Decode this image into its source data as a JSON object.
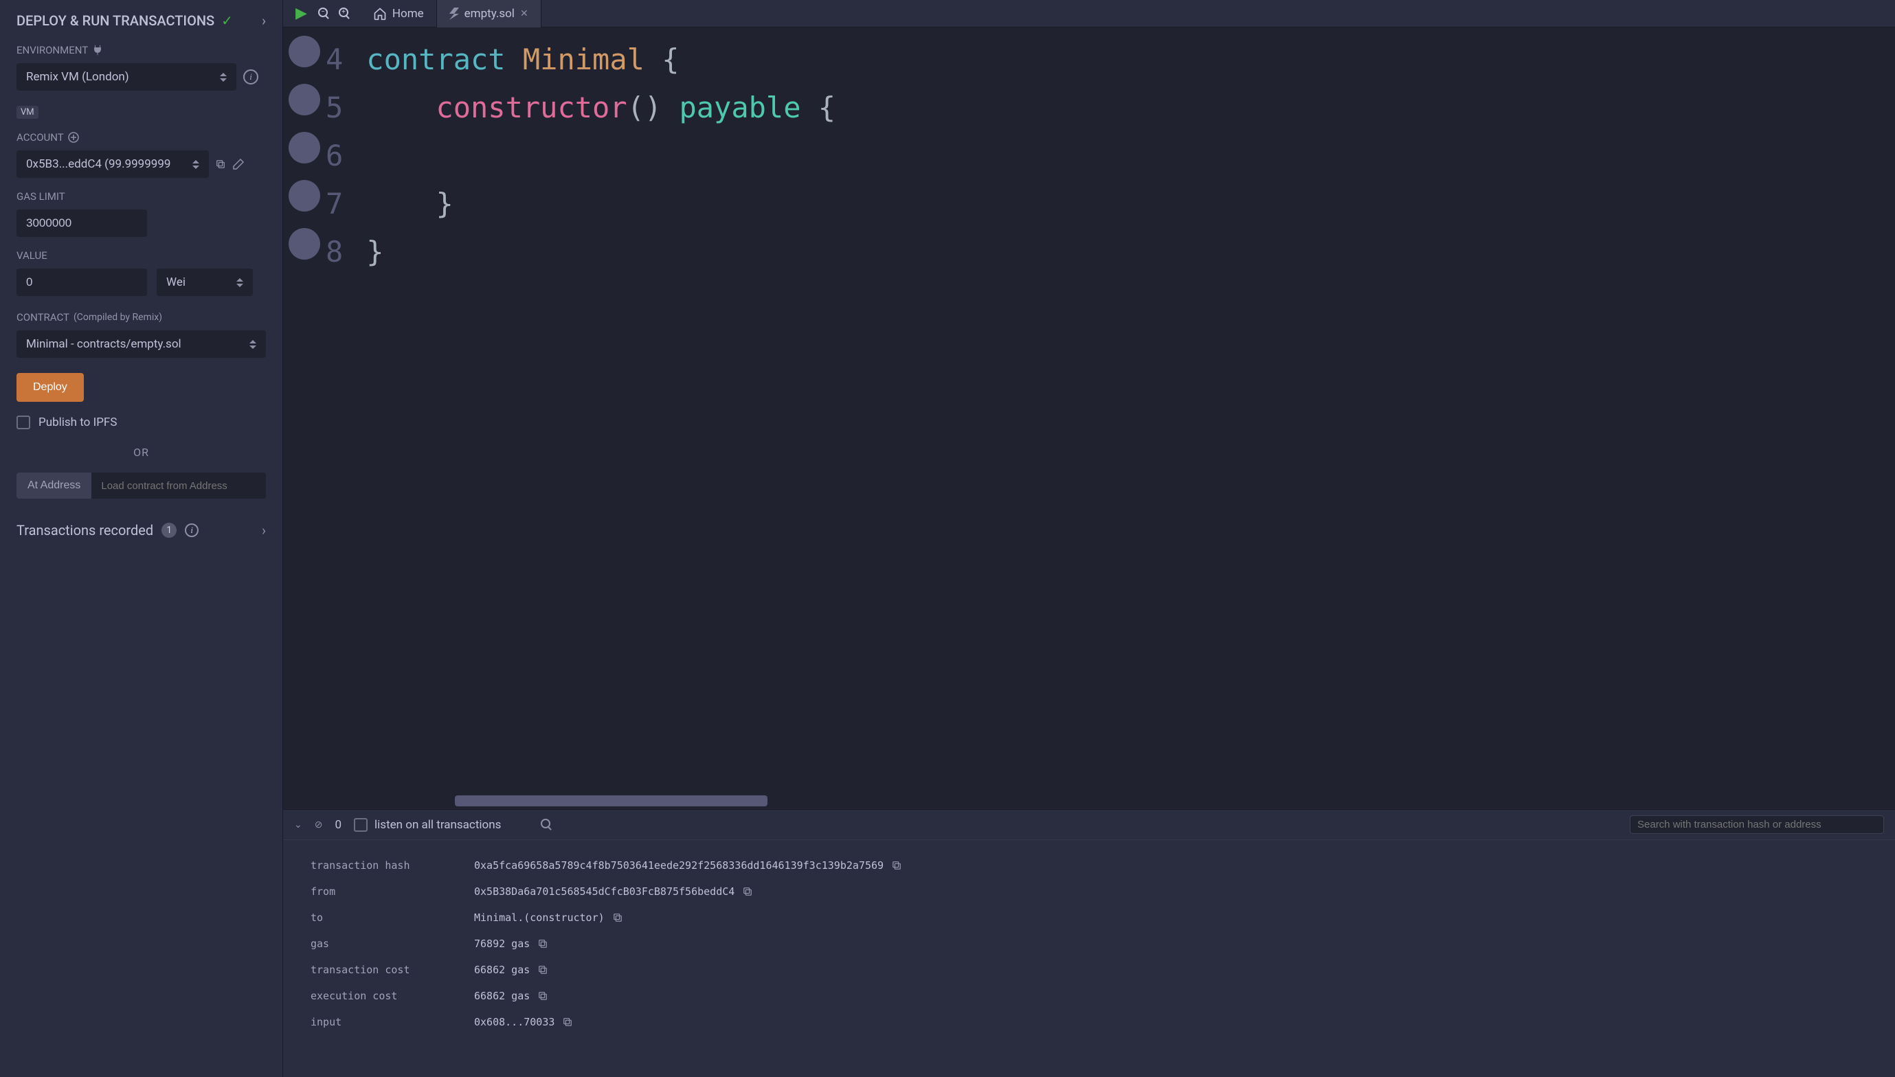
{
  "sidebar": {
    "title": "DEPLOY & RUN TRANSACTIONS",
    "environment": {
      "label": "ENVIRONMENT",
      "value": "Remix VM (London)",
      "badge": "VM"
    },
    "account": {
      "label": "ACCOUNT",
      "value": "0x5B3...eddC4 (99.9999999"
    },
    "gas_limit": {
      "label": "GAS LIMIT",
      "value": "3000000"
    },
    "value": {
      "label": "VALUE",
      "amount": "0",
      "unit": "Wei"
    },
    "contract": {
      "label": "CONTRACT",
      "hint": "(Compiled by Remix)",
      "selected": "Minimal - contracts/empty.sol"
    },
    "deploy_label": "Deploy",
    "publish_ipfs_label": "Publish to IPFS",
    "or_label": "OR",
    "at_address_label": "At Address",
    "at_address_placeholder": "Load contract from Address",
    "transactions_recorded": {
      "label": "Transactions recorded",
      "count": "1"
    }
  },
  "tabs": {
    "home": "Home",
    "file": "empty.sol"
  },
  "editor": {
    "lines": [
      {
        "num": "4",
        "parts": [
          {
            "t": "contract",
            "c": "kw-contract"
          },
          {
            "t": " ",
            "c": ""
          },
          {
            "t": "Minimal",
            "c": "kw-name"
          },
          {
            "t": " ",
            "c": ""
          },
          {
            "t": "{",
            "c": "brace"
          }
        ]
      },
      {
        "num": "5",
        "parts": [
          {
            "t": "    ",
            "c": ""
          },
          {
            "t": "constructor",
            "c": "kw-constructor"
          },
          {
            "t": "()",
            "c": "op-paren"
          },
          {
            "t": " ",
            "c": ""
          },
          {
            "t": "payable",
            "c": "kw-payable"
          },
          {
            "t": " ",
            "c": ""
          },
          {
            "t": "{",
            "c": "brace"
          }
        ]
      },
      {
        "num": "6",
        "parts": []
      },
      {
        "num": "7",
        "parts": [
          {
            "t": "    ",
            "c": ""
          },
          {
            "t": "}",
            "c": "brace"
          }
        ]
      },
      {
        "num": "8",
        "parts": [
          {
            "t": "}",
            "c": "brace"
          }
        ]
      }
    ]
  },
  "terminal": {
    "pending_count": "0",
    "listen_label": "listen on all transactions",
    "search_placeholder": "Search with transaction hash or address",
    "details": [
      {
        "key": "transaction hash",
        "val": "0xa5fca69658a5789c4f8b7503641eede292f2568336dd1646139f3c139b2a7569",
        "copy": true
      },
      {
        "key": "from",
        "val": "0x5B38Da6a701c568545dCfcB03FcB875f56beddC4",
        "copy": true
      },
      {
        "key": "to",
        "val": "Minimal.(constructor)",
        "copy": true
      },
      {
        "key": "gas",
        "val": "76892 gas",
        "copy": true
      },
      {
        "key": "transaction cost",
        "val": "66862 gas",
        "copy": true
      },
      {
        "key": "execution cost",
        "val": "66862 gas",
        "copy": true
      },
      {
        "key": "input",
        "val": "0x608...70033",
        "copy": true
      }
    ]
  }
}
